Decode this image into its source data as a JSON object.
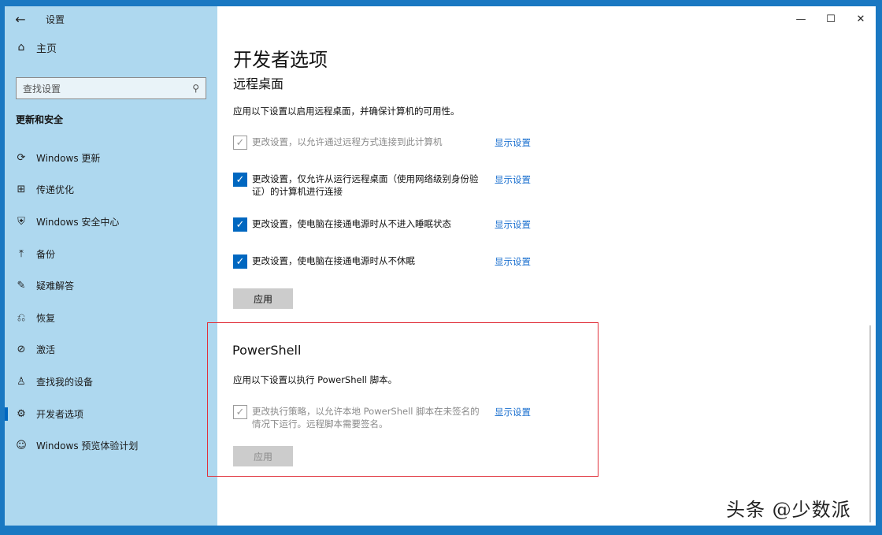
{
  "window": {
    "app_title": "设置",
    "back_icon": "back-arrow-icon",
    "minimize_glyph": "—",
    "maximize_glyph": "☐",
    "close_glyph": "✕"
  },
  "sidebar": {
    "home_label": "主页",
    "search_placeholder": "查找设置",
    "section_label": "更新和安全",
    "items": [
      {
        "label": "Windows 更新",
        "icon": "refresh-icon",
        "glyph": "⟳"
      },
      {
        "label": "传递优化",
        "icon": "delivery-icon",
        "glyph": "⊞"
      },
      {
        "label": "Windows 安全中心",
        "icon": "shield-icon",
        "glyph": "⛨"
      },
      {
        "label": "备份",
        "icon": "backup-icon",
        "glyph": "⤒"
      },
      {
        "label": "疑难解答",
        "icon": "wrench-icon",
        "glyph": "✎"
      },
      {
        "label": "恢复",
        "icon": "recovery-icon",
        "glyph": "⎌"
      },
      {
        "label": "激活",
        "icon": "activation-icon",
        "glyph": "⊘"
      },
      {
        "label": "查找我的设备",
        "icon": "person-icon",
        "glyph": "♙"
      },
      {
        "label": "开发者选项",
        "icon": "developer-icon",
        "glyph": "⚙"
      },
      {
        "label": "Windows 预览体验计划",
        "icon": "insider-icon",
        "glyph": "☺"
      }
    ],
    "active_index": 8
  },
  "main": {
    "page_title": "开发者选项",
    "remote": {
      "title": "远程桌面",
      "description": "应用以下设置以启用远程桌面，并确保计算机的可用性。",
      "options": [
        {
          "text": "更改设置，以允许通过远程方式连接到此计算机",
          "checked": true,
          "disabled": true,
          "link": "显示设置"
        },
        {
          "text": "更改设置，仅允许从运行远程桌面（使用网络级别身份验证）的计算机进行连接",
          "checked": true,
          "disabled": false,
          "link": "显示设置"
        },
        {
          "text": "更改设置，使电脑在接通电源时从不进入睡眠状态",
          "checked": true,
          "disabled": false,
          "link": "显示设置"
        },
        {
          "text": "更改设置，使电脑在接通电源时从不休眠",
          "checked": true,
          "disabled": false,
          "link": "显示设置"
        }
      ],
      "apply_label": "应用"
    },
    "powershell": {
      "title": "PowerShell",
      "description": "应用以下设置以执行 PowerShell 脚本。",
      "option": {
        "text": "更改执行策略，以允许本地 PowerShell 脚本在未签名的情况下运行。远程脚本需要签名。",
        "checked": true,
        "disabled": true,
        "link": "显示设置"
      },
      "apply_label": "应用"
    }
  },
  "watermark": "头条 @少数派",
  "colors": {
    "accent": "#0067c0",
    "sidebar_bg": "#aed8ef",
    "highlight": "#e0313b",
    "link": "#1a6fcf"
  }
}
